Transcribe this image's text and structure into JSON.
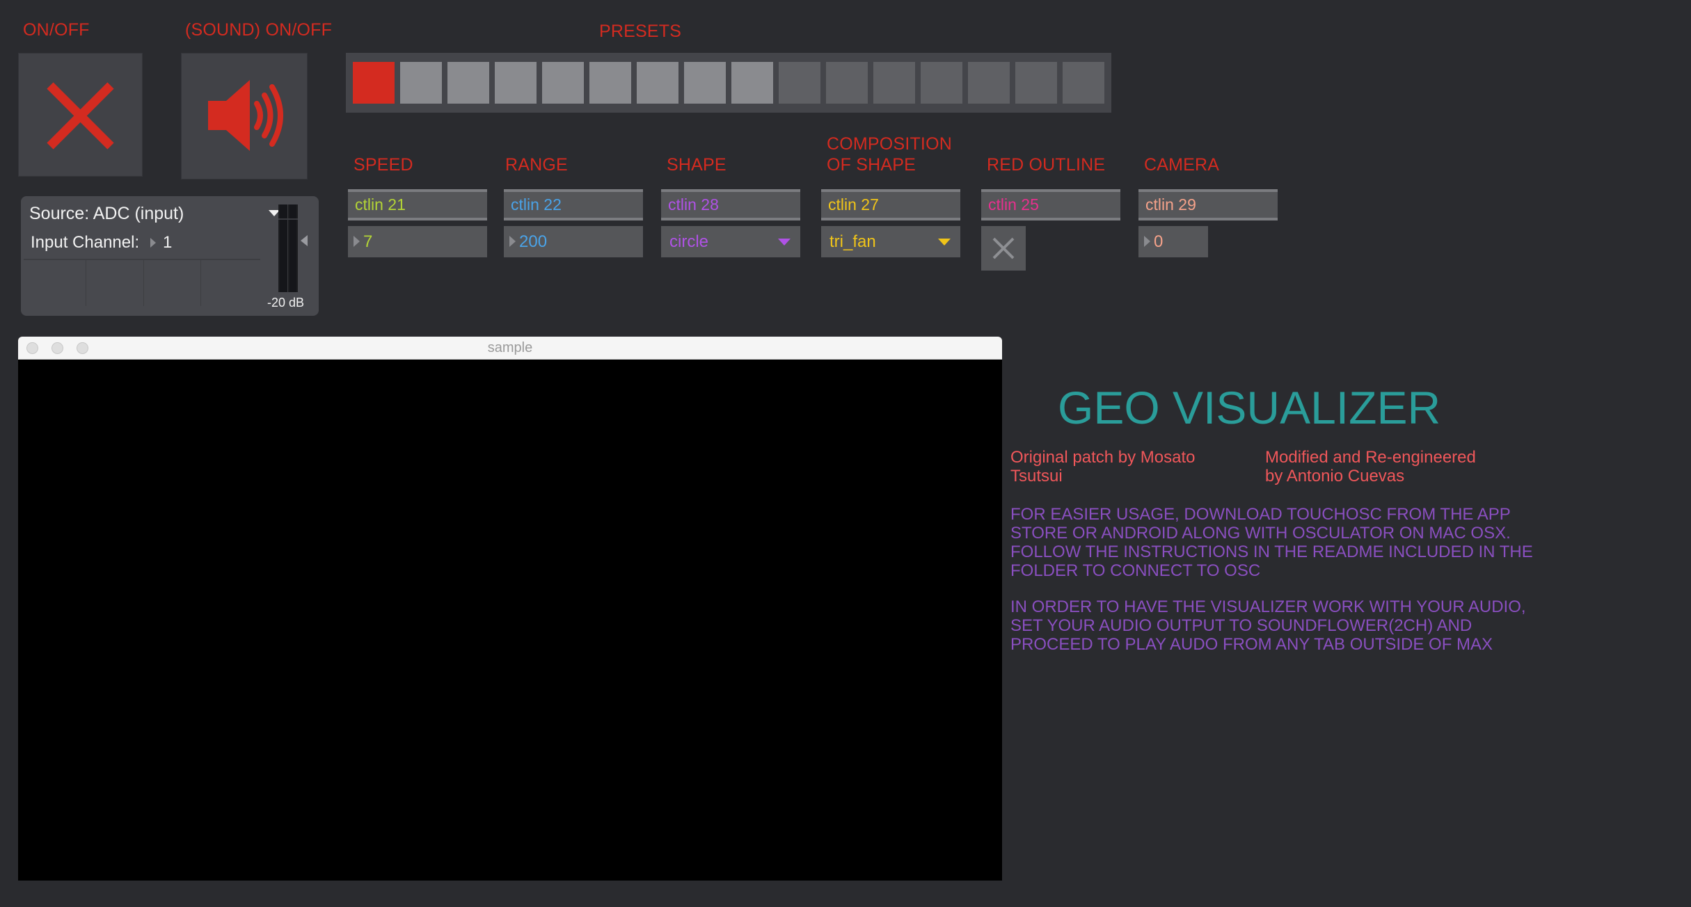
{
  "labels": {
    "on_off": "ON/OFF",
    "sound_on_off": "(SOUND) ON/OFF",
    "presets": "PRESETS",
    "speed": "SPEED",
    "range": "RANGE",
    "shape": "SHAPE",
    "composition_line1": "COMPOSITION",
    "composition_line2": "OF SHAPE",
    "red_outline": "RED OUTLINE",
    "camera": "CAMERA"
  },
  "presets": {
    "count": 16,
    "active_index": 0,
    "states": [
      "active",
      "light",
      "light",
      "light",
      "light",
      "light",
      "light",
      "light",
      "light",
      "dark",
      "dark",
      "dark",
      "dark",
      "dark",
      "dark",
      "dark"
    ],
    "colors": {
      "active": "#d42b20",
      "light": "#8a8b8f",
      "dark": "#5f6064"
    }
  },
  "controls": {
    "speed": {
      "ctl": "ctlin 21",
      "value": "7",
      "color": "#b3d436"
    },
    "range": {
      "ctl": "ctlin 22",
      "value": "200",
      "color": "#4aa3e8"
    },
    "shape": {
      "ctl": "ctlin 28",
      "value": "circle",
      "color": "#b052e6"
    },
    "composition": {
      "ctl": "ctlin 27",
      "value": "tri_fan",
      "color": "#f0c419"
    },
    "red_outline": {
      "ctl": "ctlin 25",
      "color": "#e8308e"
    },
    "camera": {
      "ctl": "ctlin 29",
      "value": "0",
      "color": "#f5a28a"
    }
  },
  "audio": {
    "source_label": "Source: ADC (input)",
    "input_channel_label": "Input Channel:",
    "input_channel_value": "1",
    "meter_db": "-20 dB"
  },
  "window": {
    "title": "sample"
  },
  "info": {
    "title": "GEO VISUALIZER",
    "credit_original": "Original patch by Mosato Tsutsui",
    "credit_modified": "Modified and Re-engineered by Antonio Cuevas",
    "note1": "FOR EASIER USAGE, DOWNLOAD TOUCHOSC FROM THE APP STORE OR ANDROID ALONG WITH OSCULATOR ON MAC OSX. FOLLOW THE INSTRUCTIONS IN THE README INCLUDED IN THE FOLDER TO CONNECT TO OSC",
    "note2": "IN ORDER TO HAVE THE VISUALIZER WORK WITH YOUR AUDIO, SET YOUR AUDIO OUTPUT TO SOUNDFLOWER(2CH) AND PROCEED TO PLAY AUDO FROM ANY TAB OUTSIDE OF MAX"
  },
  "colors": {
    "accent_red": "#d42b20",
    "title_teal": "#2a9d9a",
    "credit_red": "#f0575a",
    "note_purple": "#8a4fc0"
  },
  "icons": {
    "on_off": "close-x-icon",
    "sound": "speaker-icon",
    "outline_toggle": "x-toggle-icon"
  }
}
